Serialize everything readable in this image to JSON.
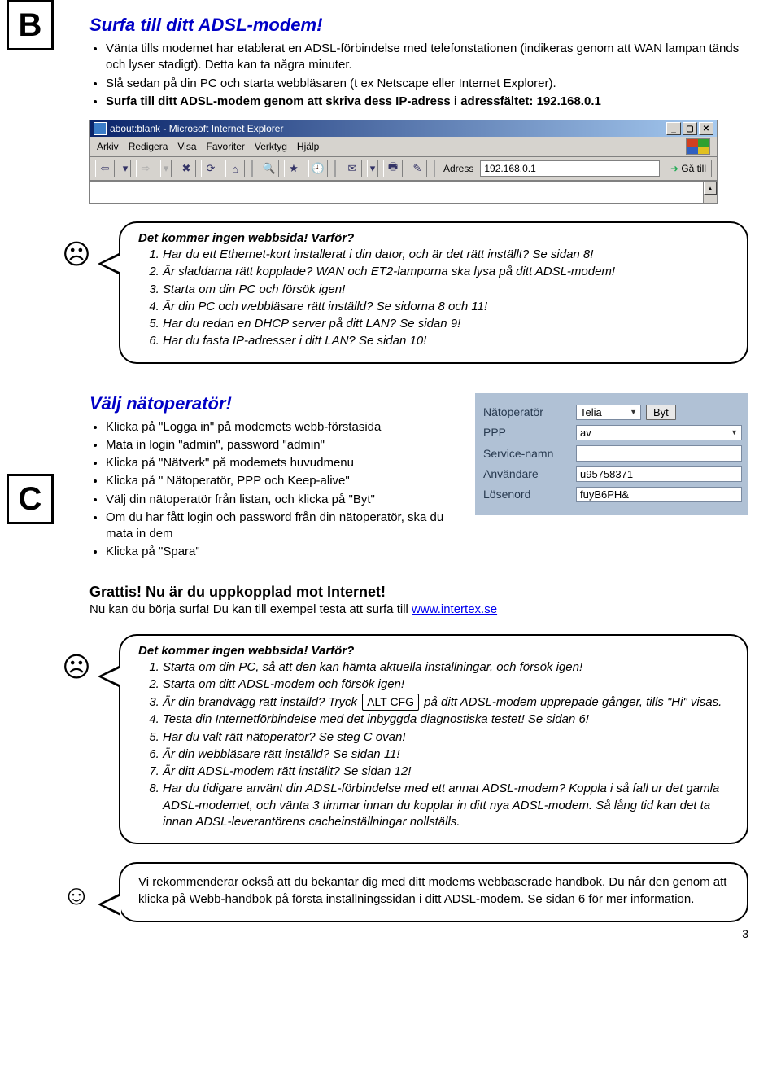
{
  "letters": {
    "b": "B",
    "c": "C"
  },
  "sectionB": {
    "heading": "Surfa till ditt ADSL-modem!",
    "bullets": [
      "Vänta tills modemet har etablerat en ADSL-förbindelse med telefonstationen (indikeras genom att WAN lampan tänds och lyser stadigt). Detta kan ta några minuter.",
      "Slå sedan på din PC och starta webbläsaren (t ex Netscape eller Internet Explorer).",
      "Surfa till ditt ADSL-modem genom att skriva dess IP-adress i adressfältet: 192.168.0.1"
    ]
  },
  "ie": {
    "title": "about:blank - Microsoft Internet Explorer",
    "menu": {
      "arkiv": "Arkiv",
      "redigera": "Redigera",
      "visa": "Visa",
      "favoriter": "Favoriter",
      "verktyg": "Verktyg",
      "hjalp": "Hjälp"
    },
    "toolbar": {
      "back": "⇦",
      "backdrop": "▾",
      "fwd": "⇨",
      "fwddrop": "▾",
      "stop": "✖",
      "refresh": "⟳",
      "home": "⌂",
      "search": "🔍",
      "fav": "★",
      "history": "🕘",
      "mail": "✉",
      "maildrop": "▾",
      "print": "🖶",
      "edit": "✎"
    },
    "addressLabel": "Adress",
    "addressValue": "192.168.0.1",
    "go": "Gå till",
    "winbtns": {
      "min": "_",
      "max": "▢",
      "close": "✕"
    },
    "scrollthumb": "▴"
  },
  "bubble1": {
    "title": "Det kommer ingen webbsida! Varför?",
    "items": [
      "Har du ett Ethernet-kort installerat i din dator, och är det rätt inställt? Se sidan 8!",
      "Är sladdarna rätt kopplade? WAN och ET2-lamporna ska lysa på ditt ADSL-modem!",
      "Starta om din PC och försök igen!",
      "Är din PC och webbläsare rätt inställd? Se sidorna 8 och 11!",
      "Har du redan en DHCP server på ditt LAN? Se sidan 9!",
      "Har du fasta IP-adresser i ditt LAN? Se sidan 10!"
    ]
  },
  "sectionC": {
    "heading": "Välj nätoperatör!",
    "bullets": [
      "Klicka på \"Logga in\" på modemets webb-förstasida",
      "Mata in login \"admin\", password \"admin\"",
      "Klicka på \"Nätverk\" på modemets huvudmenu",
      "Klicka på \" Nätoperatör, PPP och Keep-alive\"",
      "Välj din nätoperatör från listan, och klicka på \"Byt\"",
      "Om du har fått login och password från din nätoperatör, ska du mata in dem",
      "Klicka på \"Spara\""
    ]
  },
  "form": {
    "natoperatorLabel": "Nätoperatör",
    "natoperatorValue": "Telia",
    "byt": "Byt",
    "pppLabel": "PPP",
    "pppValue": "av",
    "serviceLabel": "Service-namn",
    "serviceValue": "",
    "userLabel": "Användare",
    "userValue": "u95758371",
    "pwdLabel": "Lösenord",
    "pwdValue": "fuyB6PH&"
  },
  "congrats": {
    "title": "Grattis! Nu är du uppkopplad mot Internet!",
    "text": "Nu kan du börja surfa! Du kan till exempel testa att surfa till ",
    "link": "www.intertex.se"
  },
  "bubble2": {
    "title": "Det kommer ingen webbsida! Varför?",
    "items1to2": [
      "Starta om din PC, så att den kan hämta aktuella inställningar, och försök igen!",
      "Starta om ditt ADSL-modem och försök igen!"
    ],
    "item3pre": "Är din brandvägg rätt inställd? Tryck ",
    "item3btn": "ALT CFG",
    "item3post": " på ditt ADSL-modem upprepade gånger, tills \"Hi\" visas.",
    "items4to8": [
      "Testa din Internetförbindelse med det inbyggda diagnostiska testet! Se sidan 6!",
      "Har du valt rätt nätoperatör? Se steg C ovan!",
      "Är din webbläsare rätt inställd? Se sidan 11!",
      "Är ditt ADSL-modem rätt inställt? Se sidan 12!",
      "Har du tidigare använt din ADSL-förbindelse med ett annat ADSL-modem? Koppla i så fall ur det gamla ADSL-modemet, och vänta 3 timmar innan du kopplar in ditt nya ADSL-modem. Så lång tid kan det ta innan ADSL-leverantörens cacheinställningar nollställs."
    ]
  },
  "bubble3": {
    "pre": "Vi rekommenderar också att du bekantar dig med ditt modems webbaserade handbok. Du når den genom att klicka på ",
    "link": "Webb-handbok",
    "post": " på första inställningssidan i ditt ADSL-modem. Se sidan 6 för mer information."
  },
  "faces": {
    "sad": "☹",
    "happy": "☺"
  },
  "pageNumber": "3"
}
